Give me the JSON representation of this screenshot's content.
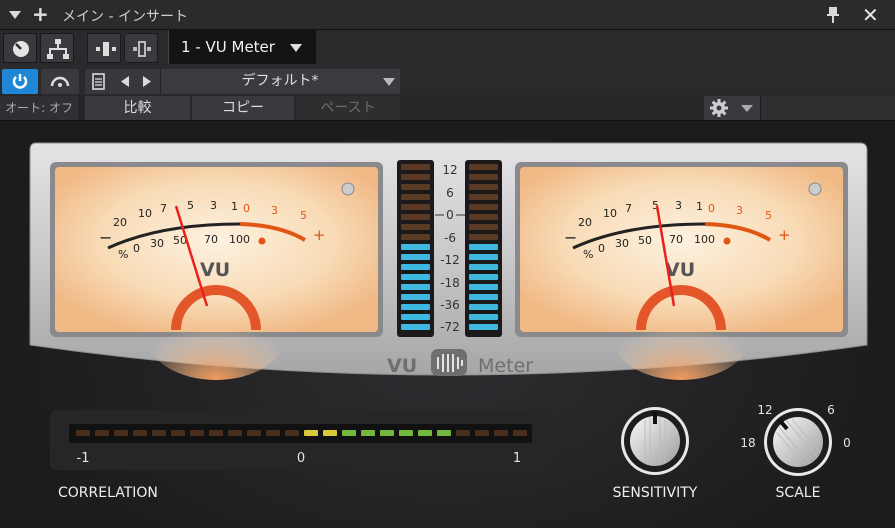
{
  "window": {
    "title": "メイン - インサート"
  },
  "toolbar": {
    "preset_slot": "1 - VU Meter",
    "preset_name": "デフォルト*",
    "auto_label": "オート: オフ",
    "compare_label": "比較",
    "copy_label": "コピー",
    "paste_label": "ペースト"
  },
  "meter_left": {
    "scale_top": [
      "20",
      "10",
      "7",
      "5",
      "3",
      "1",
      "0",
      "3",
      "5"
    ],
    "scale_bottom": [
      "%",
      "0",
      "30",
      "50",
      "70",
      "100"
    ],
    "minus": "−",
    "plus": "+",
    "label": "VU"
  },
  "meter_right": {
    "scale_top": [
      "20",
      "10",
      "7",
      "5",
      "3",
      "1",
      "0",
      "3",
      "5"
    ],
    "scale_bottom": [
      "%",
      "0",
      "30",
      "50",
      "70",
      "100"
    ],
    "minus": "−",
    "plus": "+",
    "label": "VU"
  },
  "peak_scale": [
    "12",
    "6",
    "0",
    "-6",
    "-12",
    "-18",
    "-36",
    "-72"
  ],
  "brand": {
    "vu": "VU",
    "meter": "Meter"
  },
  "correlation": {
    "label": "CORRELATION",
    "min": "-1",
    "mid": "0",
    "max": "1"
  },
  "sensitivity": {
    "label": "SENSITIVITY"
  },
  "scale_knob": {
    "label": "SCALE",
    "ticks": [
      "12",
      "6",
      "18",
      "0"
    ]
  },
  "colors": {
    "accent_blue": "#1f87d6",
    "meter_face": "#f6d2a8",
    "needle": "#e8221b",
    "overload": "#e85a12",
    "peak_led": "#3fb8e0"
  }
}
